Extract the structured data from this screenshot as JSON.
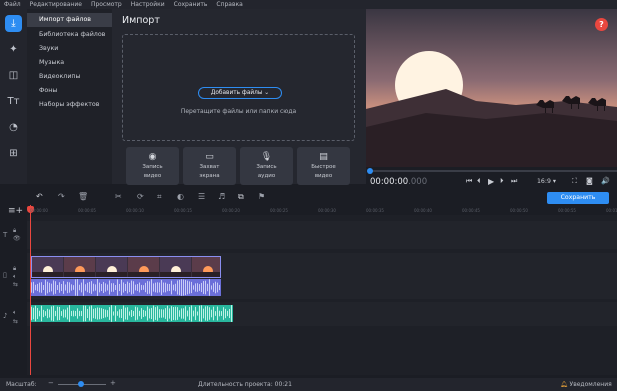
{
  "menu": [
    "Файл",
    "Редактирование",
    "Просмотр",
    "Настройки",
    "Сохранить",
    "Справка"
  ],
  "sidebar_icons": [
    "import-icon",
    "magic-wand-icon",
    "transitions-icon",
    "titles-icon",
    "stickers-icon",
    "more-tools-icon"
  ],
  "categories": [
    "Импорт файлов",
    "Библиотека файлов",
    "Звуки",
    "Музыка",
    "Видеоклипы",
    "Фоны",
    "Наборы эффектов"
  ],
  "import": {
    "title": "Импорт",
    "add_files": "Добавить файлы",
    "drop_hint": "Перетащите файлы или папки сюда",
    "capture_buttons": [
      {
        "icon": "webcam-icon",
        "label1": "Запись",
        "label2": "видео"
      },
      {
        "icon": "screen-capture-icon",
        "label1": "Захват",
        "label2": "экрана"
      },
      {
        "icon": "microphone-icon",
        "label1": "Запись",
        "label2": "аудио"
      },
      {
        "icon": "quick-video-icon",
        "label1": "Быстрое",
        "label2": "видео"
      }
    ]
  },
  "player": {
    "timecode": "00:00:00",
    "timecode_ms": ".000",
    "ratio": "16:9 ▾",
    "progress": 0
  },
  "toolbar": {
    "save_label": "Сохранить"
  },
  "ruler": [
    "00:00:00",
    "00:00:05",
    "00:00:10",
    "00:00:15",
    "00:00:20",
    "00:00:25",
    "00:00:30",
    "00:00:35",
    "00:00:40",
    "00:00:45",
    "00:00:50",
    "00:00:55",
    "00:01:00"
  ],
  "status": {
    "scale_label": "Масштаб:",
    "duration": "Длительность проекта:  00:21",
    "notifications": "Уведомления"
  },
  "colors": {
    "accent": "#2e8df2",
    "video_clip": "#6b6fd9",
    "audio_clip": "#29b79e",
    "playhead": "#e9473f"
  }
}
